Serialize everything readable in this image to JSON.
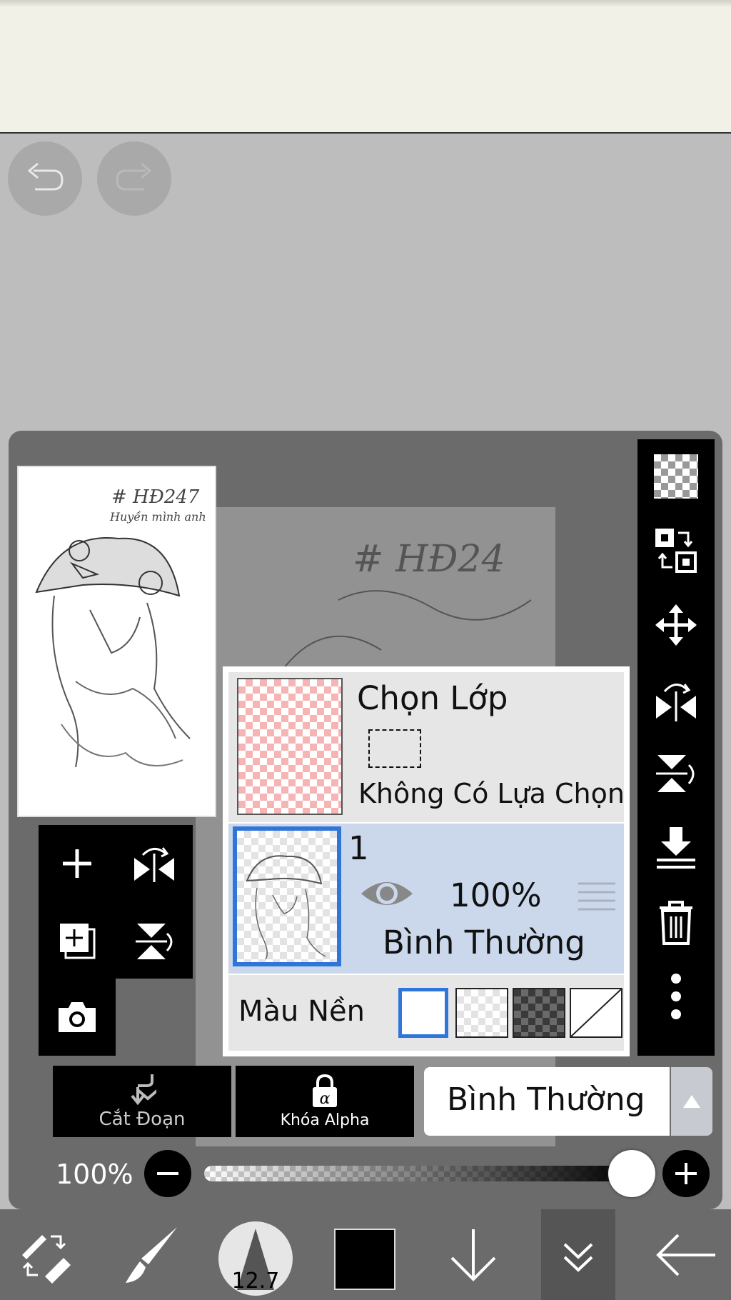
{
  "layer_menu": {
    "selection_layer": {
      "title": "Chọn Lớp",
      "status": "Không Có Lựa Chọn"
    },
    "layer": {
      "name": "1",
      "opacity": "100%",
      "blend_mode": "Bình Thường"
    },
    "background": {
      "label": "Màu Nền",
      "options": [
        "white",
        "checker-light",
        "checker-dark",
        "none"
      ],
      "selected": "white"
    }
  },
  "actions": {
    "clipping": "Cắt Đoạn",
    "alpha_lock": "Khóa Alpha",
    "blend_mode": "Bình Thường"
  },
  "opacity": {
    "label": "100%",
    "value": 1.0
  },
  "toolbar": {
    "brush_size": "12.7",
    "current_color": "#000000"
  },
  "thumbnail": {
    "caption_line1": "# HĐ247",
    "caption_line2": "Huyền mình anh"
  },
  "colors": {
    "panel": "#6b6b6b",
    "selected_layer": "#cbd8ec",
    "accent": "#2f76d8"
  }
}
